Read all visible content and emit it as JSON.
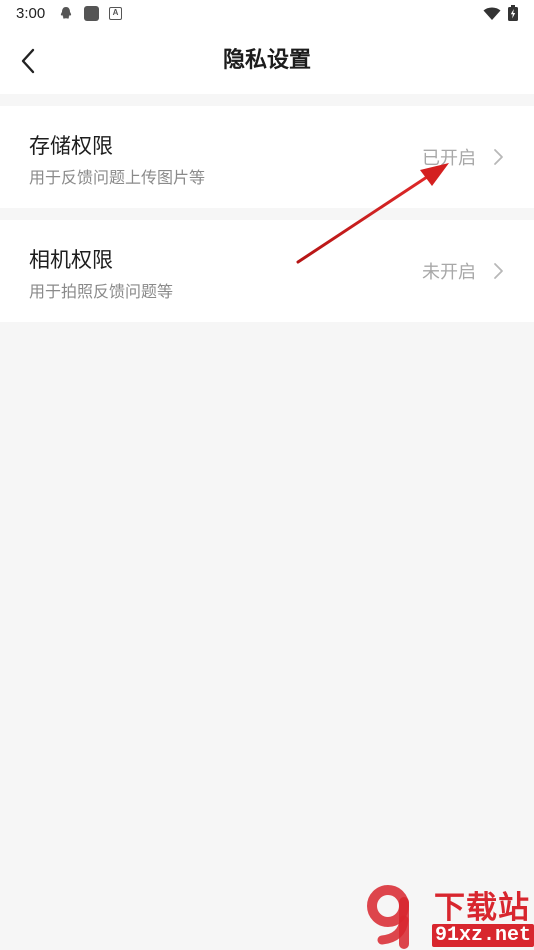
{
  "status_bar": {
    "time": "3:00",
    "icons": [
      "qq-icon",
      "app-square-icon",
      "a-badge-icon",
      "wifi-icon",
      "battery-charging-icon"
    ],
    "a_badge_text": "A"
  },
  "header": {
    "title": "隐私设置",
    "back_icon": "chevron-left-icon"
  },
  "permissions": [
    {
      "title": "存储权限",
      "description": "用于反馈问题上传图片等",
      "status": "已开启"
    },
    {
      "title": "相机权限",
      "description": "用于拍照反馈问题等",
      "status": "未开启"
    }
  ],
  "colors": {
    "background": "#f6f6f6",
    "surface": "#ffffff",
    "primary_text": "#1e1e1e",
    "secondary_text": "#8a8a8a",
    "status_text": "#a8a8a8",
    "annotation": "#d42020",
    "watermark": "#d8262e"
  },
  "watermark": {
    "name": "下载站",
    "url": "91xz.net",
    "logo": "91-logo-icon"
  }
}
